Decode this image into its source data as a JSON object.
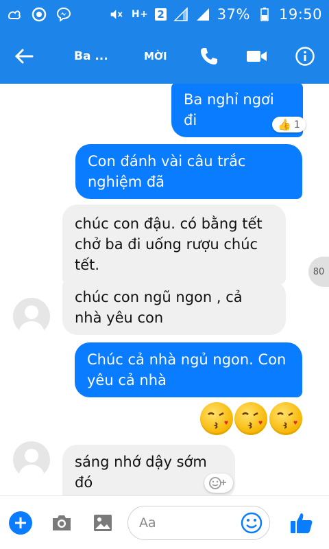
{
  "status_bar": {
    "network": "H+",
    "sim": "2",
    "battery": "37%",
    "time": "19:50"
  },
  "header": {
    "title": "Ba ...",
    "invite_label": "MỜI"
  },
  "messages": [
    {
      "side": "out",
      "text": "Ba nghỉ ngơi đi"
    },
    {
      "side": "reaction",
      "emoji": "👍",
      "count": "1"
    },
    {
      "side": "out",
      "text": "Con đánh vài câu trắc nghiệm đã"
    },
    {
      "side": "in",
      "text": "chúc con đậu. có bằng tết chở ba đi uống rượu chúc tết."
    },
    {
      "side": "in",
      "text": "chúc con ngũ ngon , cả nhà yêu con"
    },
    {
      "side": "out",
      "text": "Chúc cả nhà ngủ ngon. Con yêu cả nhà"
    },
    {
      "side": "in",
      "text": "sáng nhớ dậy sớm đó"
    }
  ],
  "scroll_badge": "80",
  "composer": {
    "placeholder": "Aa"
  },
  "icons": {
    "back": "arrow-left-icon",
    "call": "phone-icon",
    "video": "video-camera-icon",
    "info": "info-icon",
    "plus": "plus-icon",
    "camera": "camera-icon",
    "gallery": "image-icon",
    "emoji": "smiley-icon",
    "like": "thumbs-up-icon"
  },
  "colors": {
    "brand": "#1d84ea",
    "outgoing": "#0a7cff",
    "incoming": "#f0f0f0"
  }
}
